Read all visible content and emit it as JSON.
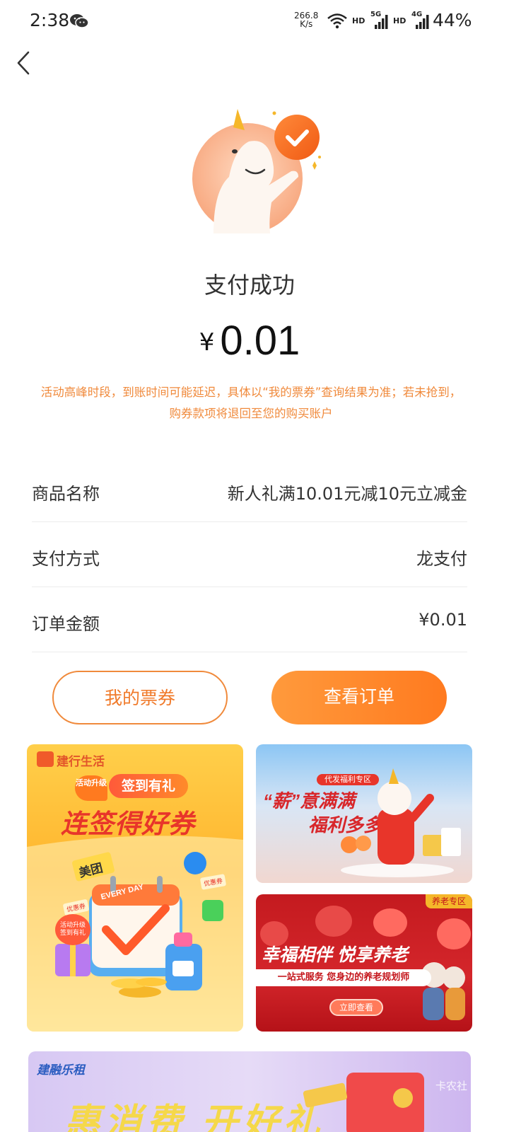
{
  "status_bar": {
    "time": "2:38",
    "speed_value": "266.8",
    "speed_unit": "K/s",
    "hd1": "HD",
    "net1": "5G",
    "hd2": "HD",
    "net2": "4G",
    "battery": "44%"
  },
  "result": {
    "title": "支付成功",
    "currency": "¥",
    "amount": "0.01",
    "notice": "活动高峰时段，到账时间可能延迟，具体以“我的票券”查询结果为准；若未抢到，购券款项将退回至您的购买账户"
  },
  "details": [
    {
      "label": "商品名称",
      "value": "新人礼满10.01元减10元立减金"
    },
    {
      "label": "支付方式",
      "value": "龙支付"
    },
    {
      "label": "订单金额",
      "value": "¥0.01"
    }
  ],
  "buttons": {
    "my_coupons": "我的票券",
    "view_order": "查看订单"
  },
  "banners": {
    "left": {
      "brand": "建行生活",
      "tag": "活动升级",
      "subtitle": "签到有礼",
      "headline": "连签得好券",
      "meituan": "美团",
      "every_day": "EVERY DAY",
      "chip1": "优惠券",
      "chip2": "优惠券",
      "badge": "活动升级签到有礼"
    },
    "right_top": {
      "tag": "代发福利专区",
      "line1": "“薪”意满满",
      "line2": "福利多多"
    },
    "right_bottom": {
      "tag": "养老专区",
      "headline": "幸福相伴 悦享养老",
      "subline": "一站式服务 您身边的养老规划师",
      "cta": "立即查看"
    },
    "bottom": {
      "brand": "建融乐租",
      "headline": "惠消费 开好礼",
      "watermark": "卡农社"
    }
  },
  "colors": {
    "accent": "#f07a2a",
    "notice": "#f08a3c",
    "divider": "#ececec"
  }
}
